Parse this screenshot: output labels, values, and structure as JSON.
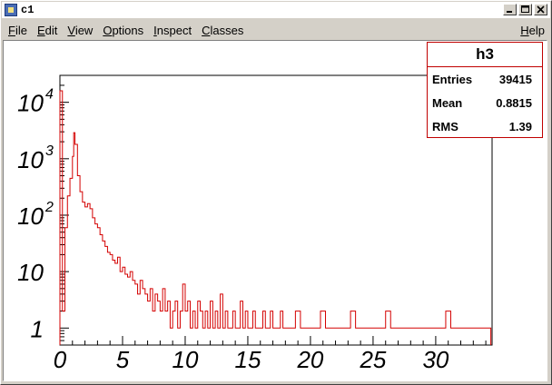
{
  "window": {
    "title": "c1",
    "icon": "root-canvas-icon",
    "buttons": [
      "minimize-icon",
      "maximize-icon",
      "close-icon"
    ]
  },
  "menu": {
    "items": [
      "File",
      "Edit",
      "View",
      "Options",
      "Inspect",
      "Classes"
    ],
    "help": "Help"
  },
  "stats": {
    "title": "h3",
    "rows": [
      {
        "label": "Entries",
        "value": "39415"
      },
      {
        "label": "Mean",
        "value": "0.8815"
      },
      {
        "label": "RMS",
        "value": "1.39"
      }
    ]
  },
  "colors": {
    "histogram_line": "#d40000",
    "stats_border": "#c00000",
    "background": "#d4d0c8"
  },
  "chart_data": {
    "type": "line",
    "title": "",
    "xlabel": "",
    "ylabel": "",
    "xlim": [
      0,
      34.5
    ],
    "ylim": [
      0.5,
      30000
    ],
    "yscale": "log",
    "grid": false,
    "legend": "none",
    "x_ticks": [
      "0",
      "5",
      "10",
      "15",
      "20",
      "25",
      "30"
    ],
    "y_ticks": [
      {
        "label": "1",
        "exp": ""
      },
      {
        "label": "10",
        "exp": ""
      },
      {
        "label": "10",
        "exp": "2"
      },
      {
        "label": "10",
        "exp": "3"
      },
      {
        "label": "10",
        "exp": "4"
      }
    ],
    "series": [
      {
        "x": [
          0.0,
          0.2,
          0.4,
          0.6,
          0.8,
          1.0,
          1.1,
          1.2,
          1.4,
          1.6,
          1.8,
          2.0,
          2.2,
          2.4,
          2.6,
          2.8,
          3.0,
          3.2,
          3.4,
          3.6,
          3.8,
          4.0,
          4.2,
          4.4,
          4.6,
          4.8,
          5.0,
          5.2,
          5.4,
          5.6,
          5.8,
          6.0,
          6.2,
          6.4,
          6.6,
          6.8,
          7.0,
          7.2,
          7.4,
          7.6,
          7.8,
          8.0,
          8.2,
          8.4,
          8.6,
          8.8,
          9.0,
          9.2,
          9.4,
          9.6,
          9.8,
          10.0,
          10.2,
          10.4,
          10.6,
          10.8,
          11.0,
          11.2,
          11.4,
          11.6,
          11.8,
          12.0,
          12.2,
          12.4,
          12.6,
          12.8,
          13.0,
          13.2,
          13.4,
          13.6,
          13.8,
          14.0,
          14.2,
          14.4,
          14.6,
          14.8,
          15.0,
          15.2,
          15.4,
          15.6,
          15.8,
          16.0,
          16.2,
          16.4,
          16.6,
          16.8,
          17.0,
          17.2,
          17.4,
          17.6,
          17.8,
          18.0,
          18.4,
          18.8,
          19.2,
          19.6,
          20.0,
          20.4,
          20.8,
          21.2,
          21.6,
          22.0,
          22.4,
          22.8,
          23.2,
          23.6,
          24.0,
          24.4,
          24.8,
          25.2,
          25.6,
          26.0,
          26.4,
          26.8,
          27.2,
          27.6,
          28.0,
          28.4,
          28.8,
          29.2,
          29.6,
          30.0,
          30.4,
          30.8,
          31.2,
          31.6,
          32.0,
          32.4,
          32.8,
          33.2,
          33.6,
          34.0
        ],
        "y": [
          16000,
          2,
          60,
          220,
          450,
          1100,
          2900,
          1800,
          500,
          260,
          170,
          140,
          160,
          130,
          90,
          70,
          60,
          45,
          35,
          28,
          22,
          20,
          16,
          14,
          18,
          10,
          12,
          9,
          8,
          10,
          7,
          6,
          4,
          7,
          5,
          4,
          3,
          5,
          2,
          4,
          3,
          2,
          5,
          2,
          3,
          1,
          2,
          3,
          1,
          2,
          6,
          2,
          3,
          1,
          2,
          1,
          3,
          2,
          1,
          2,
          1,
          3,
          1,
          2,
          1,
          4,
          1,
          2,
          1,
          1,
          2,
          1,
          1,
          3,
          1,
          2,
          1,
          1,
          2,
          1,
          1,
          1,
          2,
          1,
          1,
          2,
          1,
          1,
          1,
          2,
          1,
          1,
          1,
          2,
          1,
          1,
          1,
          1,
          2,
          1,
          1,
          1,
          1,
          1,
          2,
          1,
          1,
          1,
          1,
          1,
          1,
          2,
          1,
          1,
          1,
          1,
          1,
          1,
          1,
          1,
          1,
          1,
          1,
          2,
          1,
          1,
          1,
          1,
          1,
          1,
          1,
          1
        ]
      }
    ]
  }
}
